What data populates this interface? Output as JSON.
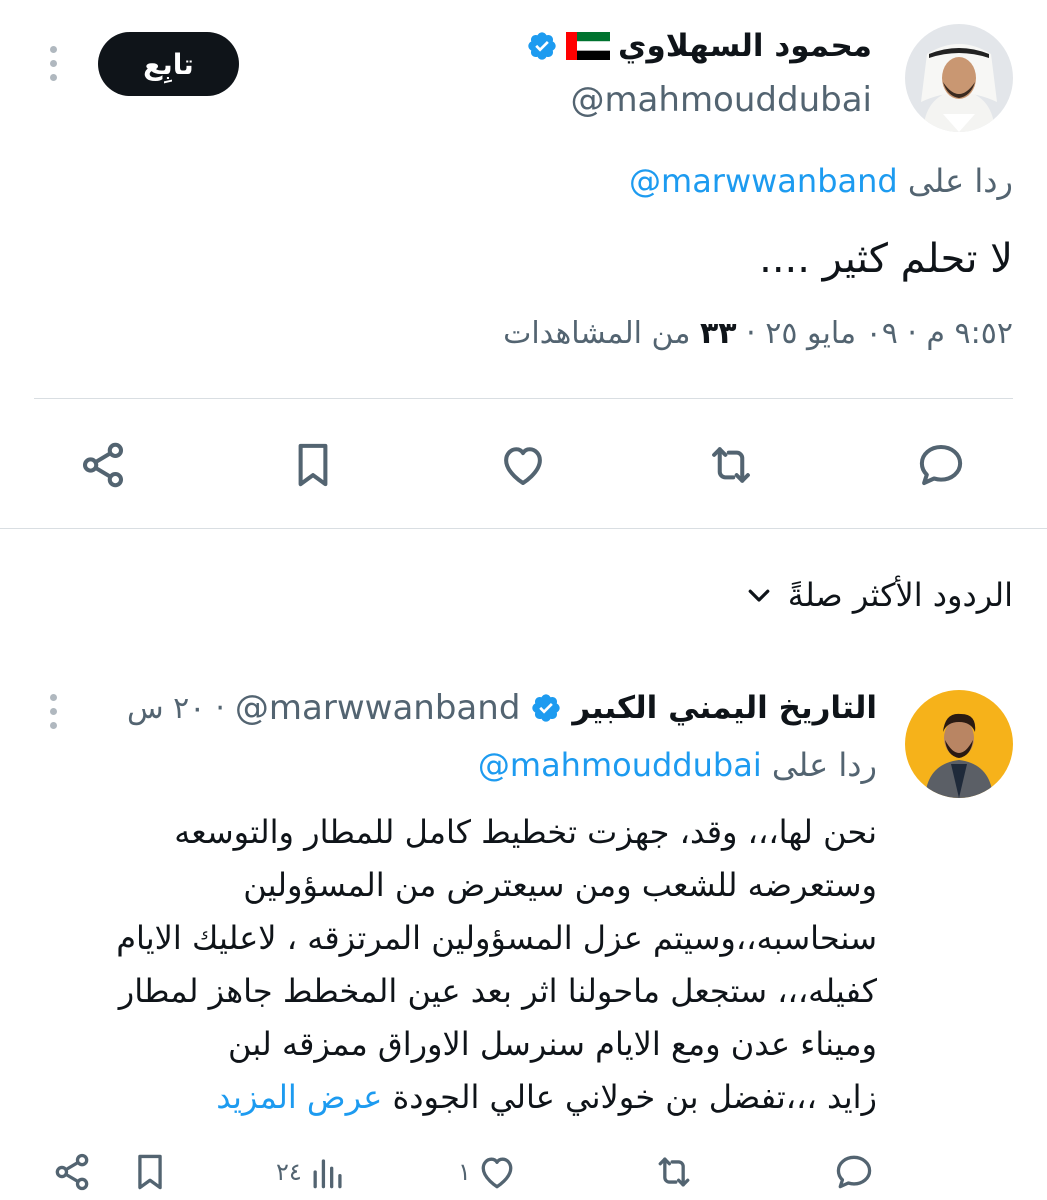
{
  "main_tweet": {
    "author_name": "محمود السهلاوي",
    "handle": "@mahmouddubai",
    "follow_label": "تابِع",
    "replying_prefix": "ردا على",
    "replying_to": "@marwwanband",
    "text": "لا تحلم كثير ....",
    "meta_datetime": "٩:٥٢ م · ٠٩ مايو ٢٥ · ",
    "views_count": "٣٣",
    "views_label": " من المشاهدات",
    "actions": [
      "reply-icon",
      "retweet-icon",
      "like-icon",
      "bookmark-icon",
      "share-icon"
    ]
  },
  "replies_sort": {
    "label": "الردود الأكثر صلةً",
    "icon": "chevron-down-icon"
  },
  "reply": {
    "author_name": "التاريخ اليمني الكبير",
    "handle": "@marwwanband",
    "separator": "·",
    "time": "٢٠ س",
    "replying_prefix": "ردا على",
    "replying_to": "@mahmouddubai",
    "lines": [
      "نحن لها،،،  وقد، جهزت تخطيط كامل للمطار والتوسعه",
      "وستعرضه للشعب ومن سيعترض من المسؤولين",
      "سنحاسبه،،وسيتم عزل المسؤولين المرتزقه ، لاعليك الايام",
      "كفيله،،، ستجعل ماحولنا اثر بعد عين   المخطط جاهز لمطار",
      "وميناء عدن ومع الايام سنرسل الاوراق ممزقه لبن",
      "زايد  ،،،تفضل بن خولاني عالي الجودة"
    ],
    "show_more": "عرض المزيد",
    "views_count": "٢٤",
    "likes_count": "١"
  },
  "colors": {
    "accent": "#1d9bf0",
    "text": "#0f1419",
    "muted": "#536471",
    "divider": "#d9dee2",
    "follow_bg": "#0f1419"
  }
}
